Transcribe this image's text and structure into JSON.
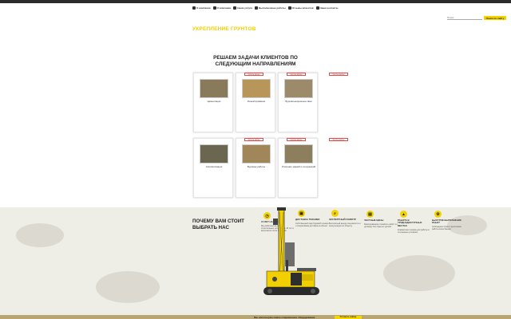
{
  "nav": {
    "items": [
      {
        "label": "О компании",
        "icon": "home-icon"
      },
      {
        "label": "О компании",
        "icon": "info-icon"
      },
      {
        "label": "Наши услуги",
        "icon": "service-icon"
      },
      {
        "label": "Выполненные работы",
        "icon": "works-icon"
      },
      {
        "label": "Отзывы клиентов",
        "icon": "reviews-icon"
      },
      {
        "label": "Наши контакты",
        "icon": "contacts-icon"
      }
    ]
  },
  "search": {
    "placeholder": "Поиск",
    "button_label": "Поиск по сайту"
  },
  "page": {
    "title": "УКРЕПЛЕНИЕ ГРУНТОВ"
  },
  "section": {
    "title": "РЕШАЕМ ЗАДАЧИ КЛИЕНТОВ ПО СЛЕДУЮЩИМ НАПРАВЛЕНИЯМ"
  },
  "cards_more_label": "Читать далее",
  "cards": [
    {
      "label": "Цементация",
      "color": "#8a7a5c"
    },
    {
      "label": "Инъектирование",
      "color": "#b8965a"
    },
    {
      "label": "Буроинъекционные сваи",
      "color": "#9c8a6a"
    },
    {
      "label": "Силикатизация",
      "color": "#6b6650"
    },
    {
      "label": "Буровые работы",
      "color": "#a08658"
    },
    {
      "label": "Усиление зданий и сооружений",
      "color": "#8d7f5e"
    }
  ],
  "why": {
    "title": "ПОЧЕМУ ВАМ СТОИТ ВЫБРАТЬ НАС",
    "features": [
      {
        "icon": "clock-icon",
        "title": "15 ЛЕТ НА РЫНКЕ",
        "text": "Мы работаем на рынке строительных услуг более 15 лет и выполнили сотни объектов."
      },
      {
        "icon": "truck-icon",
        "title": "ДОСТАВКА ТЕХНИКИ",
        "text": "Собственный парк буровой техники и оперативная доставка на объект."
      },
      {
        "icon": "search-icon",
        "title": "ЭКСПЕРТНЫЙ ОСМОТР",
        "text": "Бесплатный выезд специалиста и консультация по объекту."
      },
      {
        "icon": "document-icon",
        "title": "ЧЕСТНЫЕ ЦЕНЫ",
        "text": "Фиксированная стоимость работ по договору без скрытых доплат."
      },
      {
        "icon": "location-icon",
        "title": "РАБОТА В ТРУДНОДОСТУПНЫХ МЕСТАХ",
        "text": "Компактная техника для работы в стесненных условиях."
      },
      {
        "icon": "rig-icon",
        "title": "БЫСТРОЕ ВЫПОЛНЕНИЕ РАБОТ",
        "text": "Соблюдаем сроки и выполняем работы качественно."
      }
    ]
  },
  "footer": {
    "text": "Мы используем самое современное оборудование",
    "button_label": "Оставить заявку"
  }
}
